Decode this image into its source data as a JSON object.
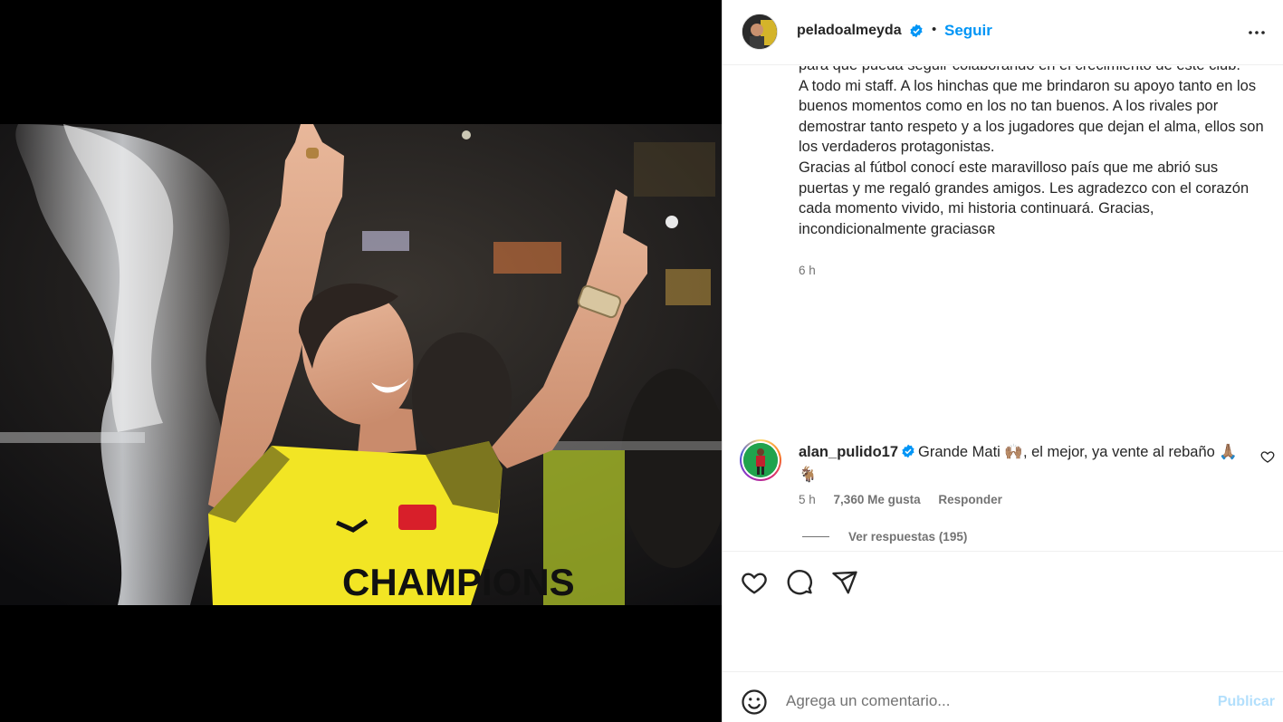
{
  "post": {
    "author": {
      "username": "peladoalmeyda",
      "verified": true,
      "separator": "•",
      "follow_label": "Seguir"
    },
    "caption": {
      "text": "para que pueda seguir colaborando en el crecimiento de este club.\nA todo mi staff. A los hinchas que me brindaron su apoyo tanto en los buenos momentos como en los no tan buenos. A los rivales por demostrar tanto respeto y a los jugadores que dejan el alma, ellos son los verdaderos protagonistas.\nGracias al fútbol conocí este maravilloso país que me abrió sus puertas y me regaló grandes amigos. Les agradezco con el corazón cada momento vivido, mi historia continuará. Gracias, incondicionalmente graciasɢʀ",
      "time": "6 h"
    },
    "image": {
      "jersey_text": "CHAMPIONS",
      "icon": "photo-man-pointing-up"
    }
  },
  "comment": {
    "username": "alan_pulido17",
    "verified": true,
    "text": "Grande Mati 🙌🏽, el mejor, ya vente al rebaño 🙏🏽 🐐",
    "time": "5 h",
    "likes": "7,360 Me gusta",
    "reply_label": "Responder",
    "view_replies_label": "Ver respuestas (195)"
  },
  "actions": {
    "like_icon": "heart-icon",
    "comment_icon": "speech-bubble-icon",
    "share_icon": "paper-plane-icon"
  },
  "composer": {
    "placeholder": "Agrega un comentario...",
    "publish_label": "Publicar"
  },
  "colors": {
    "accent": "#0095f6",
    "verified": "#0095f6",
    "publish_disabled": "#b2dffc",
    "jersey": "#f2e524",
    "background": "#000000"
  }
}
